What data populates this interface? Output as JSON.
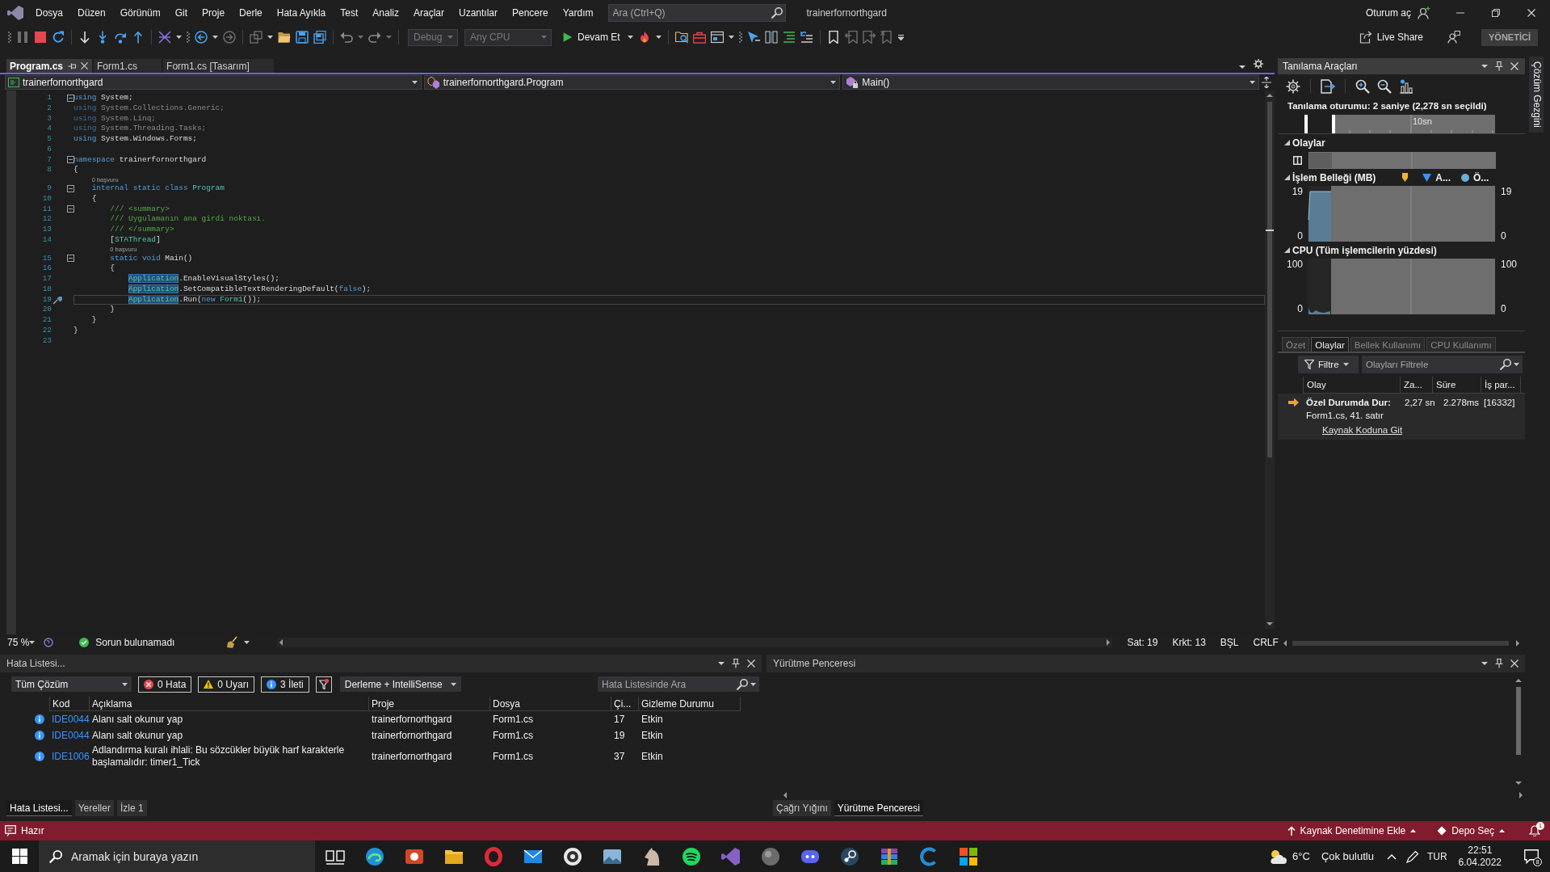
{
  "menu_bar": {
    "items": [
      "Dosya",
      "Düzen",
      "Görünüm",
      "Git",
      "Proje",
      "Derle",
      "Hata Ayıkla",
      "Test",
      "Analiz",
      "Araçlar",
      "Uzantılar",
      "Pencere",
      "Yardım"
    ],
    "search": {
      "placeholder": "Ara (Ctrl+Q)"
    },
    "solution_name": "trainerfornorthgard",
    "sign_in": "Oturum aç"
  },
  "toolbar": {
    "configuration": {
      "value": "Debug",
      "disabled": true
    },
    "platform": {
      "value": "Any CPU",
      "disabled": true
    },
    "continue_button": "Devam Et",
    "live_share": "Live Share",
    "admin_badge": "YÖNETİCİ"
  },
  "document_tabs": [
    {
      "label": "Program.cs",
      "selected": true
    },
    {
      "label": "Form1.cs",
      "selected": false
    },
    {
      "label": "Form1.cs [Tasarım]",
      "selected": false
    }
  ],
  "navigation_bar": [
    {
      "kind": "project",
      "label": "trainerfornorthgard"
    },
    {
      "kind": "class",
      "label": "trainerfornorthgard.Program"
    },
    {
      "kind": "method",
      "label": "Main()"
    }
  ],
  "editor": {
    "lines": [
      {
        "number": "1",
        "fold": true,
        "current": false,
        "tokens": [
          {
            "kind": "keyword",
            "text": "using"
          },
          {
            "kind": "plain",
            "text": " System;"
          }
        ]
      },
      {
        "number": "2",
        "fold": false,
        "current": false,
        "tokens": [
          {
            "kind": "dim_keyword",
            "text": "using"
          },
          {
            "kind": "dim_plain",
            "text": " System.Collections.Generic;"
          }
        ]
      },
      {
        "number": "3",
        "fold": false,
        "current": false,
        "tokens": [
          {
            "kind": "dim_keyword",
            "text": "using"
          },
          {
            "kind": "dim_plain",
            "text": " System.Linq;"
          }
        ]
      },
      {
        "number": "4",
        "fold": false,
        "current": false,
        "tokens": [
          {
            "kind": "dim_keyword",
            "text": "using"
          },
          {
            "kind": "dim_plain",
            "text": " System.Threading.Tasks;"
          }
        ]
      },
      {
        "number": "5",
        "fold": false,
        "current": false,
        "tokens": [
          {
            "kind": "keyword",
            "text": "using"
          },
          {
            "kind": "plain",
            "text": " System.Windows.Forms;"
          }
        ]
      },
      {
        "number": "6",
        "fold": false,
        "current": false
      },
      {
        "number": "7",
        "fold": true,
        "current": false,
        "tokens": [
          {
            "kind": "keyword",
            "text": "namespace"
          },
          {
            "kind": "plain",
            "text": " trainerfornorthgard"
          }
        ]
      },
      {
        "number": "8",
        "fold": false,
        "current": false,
        "tokens": [
          {
            "kind": "plain",
            "text": "{"
          }
        ]
      },
      {
        "number": "9",
        "fold": true,
        "current": false,
        "lens": "0 başvuru",
        "tokens": [
          {
            "kind": "keyword",
            "text": "    internal static class"
          },
          {
            "kind": "type",
            "text": " Program"
          }
        ]
      },
      {
        "number": "10",
        "fold": false,
        "current": false,
        "tokens": [
          {
            "kind": "plain",
            "text": "    {"
          }
        ]
      },
      {
        "number": "11",
        "fold": true,
        "current": false,
        "tokens": [
          {
            "kind": "comment",
            "text": "        /// <summary>"
          }
        ]
      },
      {
        "number": "12",
        "fold": false,
        "current": false,
        "tokens": [
          {
            "kind": "comment",
            "text": "        /// Uygulamanın ana girdi noktası."
          }
        ]
      },
      {
        "number": "13",
        "fold": false,
        "current": false,
        "tokens": [
          {
            "kind": "comment",
            "text": "        /// </summary>"
          }
        ]
      },
      {
        "number": "14",
        "fold": false,
        "current": false,
        "tokens": [
          {
            "kind": "plain",
            "text": "        ["
          },
          {
            "kind": "type",
            "text": "STAThread"
          },
          {
            "kind": "plain",
            "text": "]"
          }
        ]
      },
      {
        "number": "15",
        "fold": true,
        "current": false,
        "lens": "0 başvuru",
        "tokens": [
          {
            "kind": "keyword",
            "text": "        static void"
          },
          {
            "kind": "plain",
            "text": " Main()"
          }
        ]
      },
      {
        "number": "16",
        "fold": false,
        "current": false,
        "tokens": [
          {
            "kind": "plain",
            "text": "        {"
          }
        ]
      },
      {
        "number": "17",
        "fold": false,
        "current": false,
        "tokens": [
          {
            "kind": "highlight",
            "text": "            Application"
          },
          {
            "kind": "plain",
            "text": ".EnableVisualStyles();"
          }
        ]
      },
      {
        "number": "18",
        "fold": false,
        "current": false,
        "tokens": [
          {
            "kind": "highlight",
            "text": "            Application"
          },
          {
            "kind": "plain",
            "text": ".SetCompatibleTextRenderingDefault("
          },
          {
            "kind": "keyword",
            "text": "false"
          },
          {
            "kind": "plain",
            "text": ");"
          }
        ]
      },
      {
        "number": "19",
        "fold": false,
        "current": true,
        "tokens": [
          {
            "kind": "highlight",
            "text": "            Application"
          },
          {
            "kind": "plain",
            "text": ".Run("
          },
          {
            "kind": "keyword",
            "text": "new"
          },
          {
            "kind": "type",
            "text": " Form1"
          },
          {
            "kind": "plain",
            "text": "());"
          }
        ]
      },
      {
        "number": "20",
        "fold": false,
        "current": false,
        "tokens": [
          {
            "kind": "plain",
            "text": "        }"
          }
        ]
      },
      {
        "number": "21",
        "fold": false,
        "current": false,
        "tokens": [
          {
            "kind": "plain",
            "text": "    }"
          }
        ]
      },
      {
        "number": "22",
        "fold": false,
        "current": false,
        "tokens": [
          {
            "kind": "plain",
            "text": "}"
          }
        ]
      },
      {
        "number": "23",
        "fold": false,
        "current": false
      }
    ],
    "zoom": "75 %",
    "health": "Sorun bulunamadı",
    "position": [
      "Sat: 19",
      "Krkt: 13",
      "BŞL",
      "CRLF"
    ]
  },
  "diagnostics": {
    "title": "Tanılama Araçları",
    "session": "Tanılama oturumu: 2 saniye (2,278 sn seçildi)",
    "ruler_label": "10sn",
    "events_section": {
      "title": "Olaylar",
      "expanded": true
    },
    "memory_section": {
      "title": "İşlem Belleği (MB)",
      "expanded": true,
      "legend": [
        {
          "kind": "marker"
        },
        {
          "kind": "triangle",
          "label": "A..."
        },
        {
          "kind": "dot",
          "label": "Ö..."
        }
      ],
      "left_axis": [
        "19",
        "0"
      ],
      "right_axis": [
        "19",
        "0"
      ]
    },
    "cpu_section": {
      "title": "CPU (Tüm işlemcilerin yüzdesi)",
      "expanded": true,
      "left_axis": [
        "100",
        "0"
      ],
      "right_axis": [
        "100",
        "0"
      ]
    },
    "tabs": [
      {
        "label": "Özet",
        "selected": false
      },
      {
        "label": "Olaylar",
        "selected": true
      },
      {
        "label": "Bellek Kullanımı",
        "selected": false
      },
      {
        "label": "CPU Kullanımı",
        "selected": false
      }
    ],
    "filter_button": "Filtre",
    "search": {
      "placeholder": "Olayları Filtrele"
    },
    "columns": [
      "Olay",
      "Za...",
      "Süre",
      "İş par..."
    ],
    "events": [
      {
        "title": "Özel Durumda Dur:",
        "time": "2,27 sn",
        "duration": "2.278ms",
        "thread": "[16332]",
        "location": "Form1.cs, 41. satır",
        "link": "Kaynak Koduna Git"
      }
    ]
  },
  "side_tabs": [
    "Çözüm Gezgini"
  ],
  "error_list": {
    "title": "Hata Listesi...",
    "scope": "Tüm Çözüm",
    "filters": [
      {
        "kind": "error",
        "label": "0 Hata",
        "on": true
      },
      {
        "kind": "warning",
        "label": "0 Uyarı",
        "on": true
      },
      {
        "kind": "info",
        "label": "3 İleti",
        "on": true
      }
    ],
    "source": "Derleme + IntelliSense",
    "search": {
      "placeholder": "Hata Listesinde Ara"
    },
    "columns": [
      "Kod",
      "Açıklama",
      "Proje",
      "Dosya",
      "Çi...",
      "Gizleme Durumu"
    ],
    "rows": [
      {
        "kind": "info",
        "code": "IDE0044",
        "description": "Alanı salt okunur yap",
        "project": "trainerfornorthgard",
        "file": "Form1.cs",
        "line": "17",
        "suppression": "Etkin"
      },
      {
        "kind": "info",
        "code": "IDE0044",
        "description": "Alanı salt okunur yap",
        "project": "trainerfornorthgard",
        "file": "Form1.cs",
        "line": "19",
        "suppression": "Etkin"
      },
      {
        "kind": "info",
        "code": "IDE1006",
        "description": "Adlandırma kuralı ihlali: Bu sözcükler büyük harf karakterle başlamalıdır: timer1_Tick",
        "project": "trainerfornorthgard",
        "file": "Form1.cs",
        "line": "37",
        "suppression": "Etkin"
      }
    ],
    "tabs": [
      {
        "label": "Hata Listesi...",
        "selected": true
      },
      {
        "label": "Yereller",
        "selected": false
      },
      {
        "label": "İzle 1",
        "selected": false
      }
    ]
  },
  "output_panel": {
    "title": "Yürütme Penceresi",
    "tabs": [
      {
        "label": "Çağrı Yığını",
        "selected": false
      },
      {
        "label": "Yürütme Penceresi",
        "selected": true
      }
    ]
  },
  "status_bar": {
    "state": "Hazır",
    "source_control": "Kaynak Denetimine Ekle",
    "repository": "Depo Seç",
    "notifications": "1"
  },
  "taskbar": {
    "search": {
      "placeholder": "Aramak için buraya yazın"
    },
    "weather": {
      "temperature": "6°C",
      "condition": "Çok bulutlu"
    },
    "language": "TUR",
    "time": "22:51",
    "date": "6.04.2022",
    "notifications": "8"
  }
}
